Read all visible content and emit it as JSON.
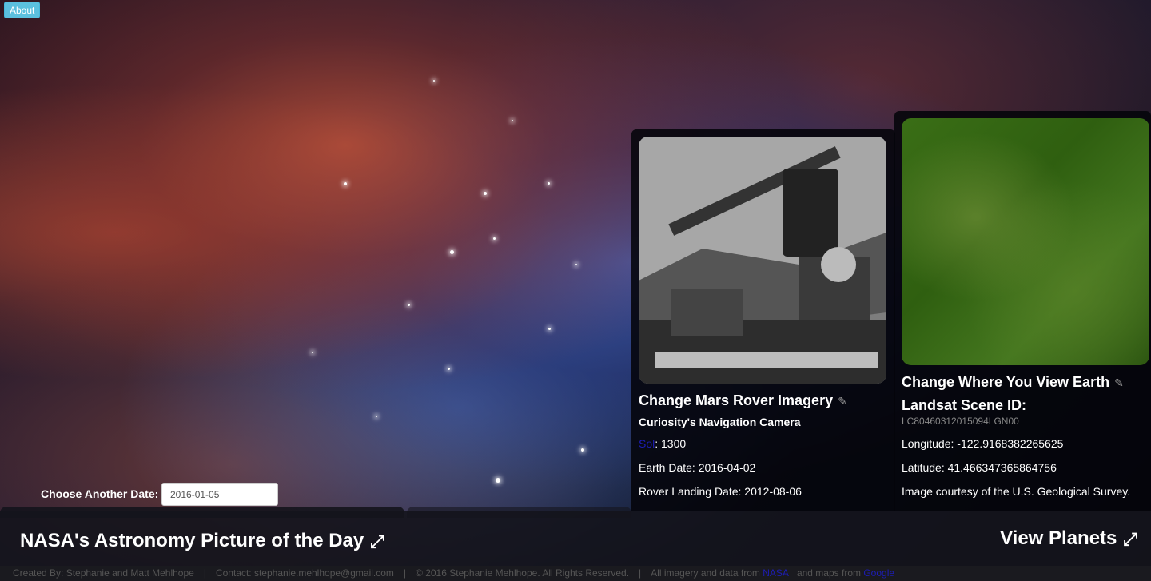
{
  "about_label": "About",
  "date_picker": {
    "label": "Choose Another Date:",
    "value": "2016-01-05"
  },
  "apod": {
    "title": "NASA's Astronomy Picture of the Day",
    "expand_icon": "expand-arrows-icon"
  },
  "view_planets": {
    "label": "View Planets",
    "expand_icon": "expand-arrows-icon"
  },
  "mars": {
    "heading": "Change Mars Rover Imagery",
    "camera": "Curiosity's Navigation Camera",
    "sol_link": "Sol",
    "sol_value": ": 1300",
    "earth_date": "Earth Date: 2016-04-02",
    "landing_date": "Rover Landing Date: 2012-08-06",
    "edit_icon": "pencil-icon"
  },
  "earth": {
    "heading": "Change Where You View Earth",
    "scene_label": "Landsat Scene ID:",
    "scene_id": "LC80460312015094LGN00",
    "longitude": "Longitude: -122.9168382265625",
    "latitude": "Latitude: 41.466347365864756",
    "credit": "Image courtesy of the U.S. Geological Survey.",
    "edit_icon": "pencil-icon"
  },
  "footer": {
    "created_by": "Created By: Stephanie and Matt Mehlhope",
    "contact": "Contact: stephanie.mehlhope@gmail.com",
    "copyright": "© 2016 Stephanie Mehlhope. All Rights Reserved.",
    "imagery_prefix": "All imagery and data from",
    "nasa_link": "NASA",
    "maps_prefix": "and maps from",
    "google_link": "Google"
  },
  "colors": {
    "about_button": "#5bc0de",
    "link": "#1d1db5",
    "earth_green": "#3a6e16"
  }
}
